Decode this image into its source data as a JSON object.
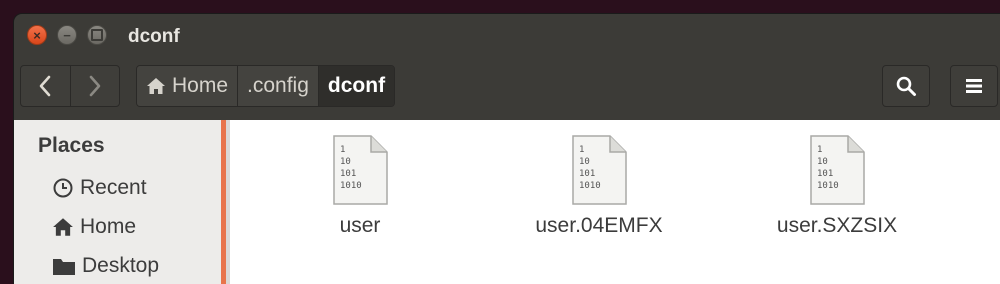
{
  "window": {
    "title": "dconf"
  },
  "toolbar": {
    "path": [
      {
        "label": "Home",
        "icon": "home-icon"
      },
      {
        "label": ".config"
      },
      {
        "label": "dconf",
        "active": true
      }
    ]
  },
  "sidebar": {
    "heading": "Places",
    "items": [
      {
        "label": "Recent",
        "icon": "clock-icon"
      },
      {
        "label": "Home",
        "icon": "home-icon"
      },
      {
        "label": "Desktop",
        "icon": "folder-icon"
      }
    ]
  },
  "files": [
    {
      "name": "user",
      "icon": "binary-file-icon",
      "icon_lines": [
        "1",
        "10",
        "101",
        "1010"
      ]
    },
    {
      "name": "user.04EMFX",
      "icon": "binary-file-icon",
      "icon_lines": [
        "1",
        "10",
        "101",
        "1010"
      ]
    },
    {
      "name": "user.SXZSIX",
      "icon": "binary-file-icon",
      "icon_lines": [
        "1",
        "10",
        "101",
        "1010"
      ]
    }
  ],
  "colors": {
    "accent": "#e8744a",
    "titlebar": "#3c3b37",
    "close": "#e8541f"
  }
}
